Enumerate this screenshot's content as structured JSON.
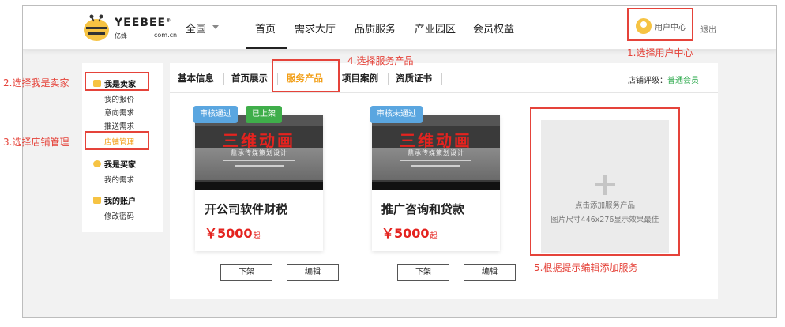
{
  "header": {
    "logo_text": "YEEBEE",
    "logo_tm": "®",
    "logo_sub": "亿蜂",
    "logo_domain": "com.cn",
    "region": "全国",
    "nav": [
      "首页",
      "需求大厅",
      "品质服务",
      "产业园区",
      "会员权益"
    ],
    "user_center": "用户中心",
    "logout": "退出"
  },
  "sidebar": {
    "seller_title": "我是卖家",
    "seller_items": [
      "我的报价",
      "意向需求",
      "推送需求",
      "店铺管理"
    ],
    "buyer_title": "我是买家",
    "buyer_items": [
      "我的需求"
    ],
    "account_title": "我的账户",
    "account_items": [
      "修改密码"
    ]
  },
  "tabs": [
    "基本信息",
    "首页展示",
    "服务产品",
    "项目案例",
    "资质证书"
  ],
  "rating": {
    "label": "店铺评级：",
    "value": "普通会员"
  },
  "cards": [
    {
      "badges": [
        "审核通过",
        "已上架"
      ],
      "image_title": "三维动画",
      "image_sub": "鼎承传媒策划设计",
      "name": "开公司软件财税",
      "price": "￥5000",
      "price_unit": "起",
      "buttons": [
        "下架",
        "编辑"
      ]
    },
    {
      "badges": [
        "审核未通过"
      ],
      "image_title": "三维动画",
      "image_sub": "鼎承传媒策划设计",
      "name": "推广咨询和贷款",
      "price": "￥5000",
      "price_unit": "起",
      "buttons": [
        "下架",
        "编辑"
      ]
    }
  ],
  "add_card": {
    "label": "点击添加服务产品",
    "hint": "图片尺寸446x276显示效果最佳"
  },
  "annotations": [
    "1.选择用户中心",
    "2.选择我是卖家",
    "3.选择店铺管理",
    "4.选择服务产品",
    "5.根据提示编辑添加服务"
  ],
  "colors": {
    "accent": "#f29d13",
    "annotation": "#e5433a",
    "price": "#e4231f",
    "approved": "#5aa6e0",
    "listed": "#3fae4a"
  }
}
